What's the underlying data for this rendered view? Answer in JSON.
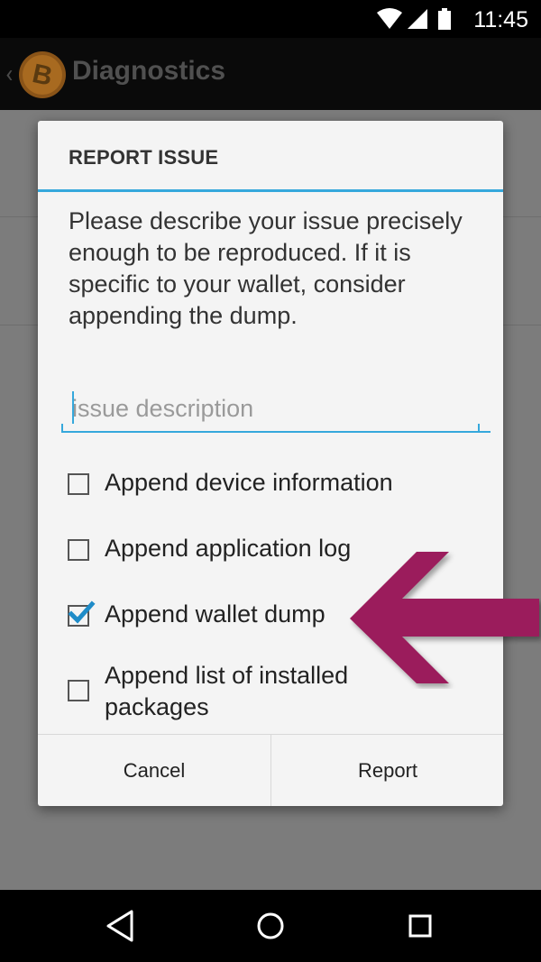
{
  "status_bar": {
    "time": "11:45",
    "icons": [
      "wifi-icon",
      "signal-icon",
      "battery-icon"
    ]
  },
  "action_bar": {
    "title": "Diagnostics",
    "logo": "bitcoin-logo",
    "logo_color": "#f7931a"
  },
  "dialog": {
    "title": "REPORT ISSUE",
    "message": "Please describe your issue precisely enough to be reproduced. If it is specific to your wallet, consider appending the dump.",
    "input": {
      "placeholder": "issue description",
      "value": ""
    },
    "options": [
      {
        "label": "Append device information",
        "checked": false
      },
      {
        "label": "Append application log",
        "checked": false
      },
      {
        "label": "Append wallet dump",
        "checked": true
      },
      {
        "label": "Append list of installed packages",
        "checked": false
      }
    ],
    "buttons": {
      "cancel": "Cancel",
      "report": "Report"
    },
    "accent_color": "#35a8dc"
  },
  "annotation": {
    "arrow_color": "#9b1f5c",
    "points_to": "Append wallet dump"
  },
  "nav_bar": {
    "icons": [
      "back-icon",
      "home-icon",
      "recents-icon"
    ]
  }
}
